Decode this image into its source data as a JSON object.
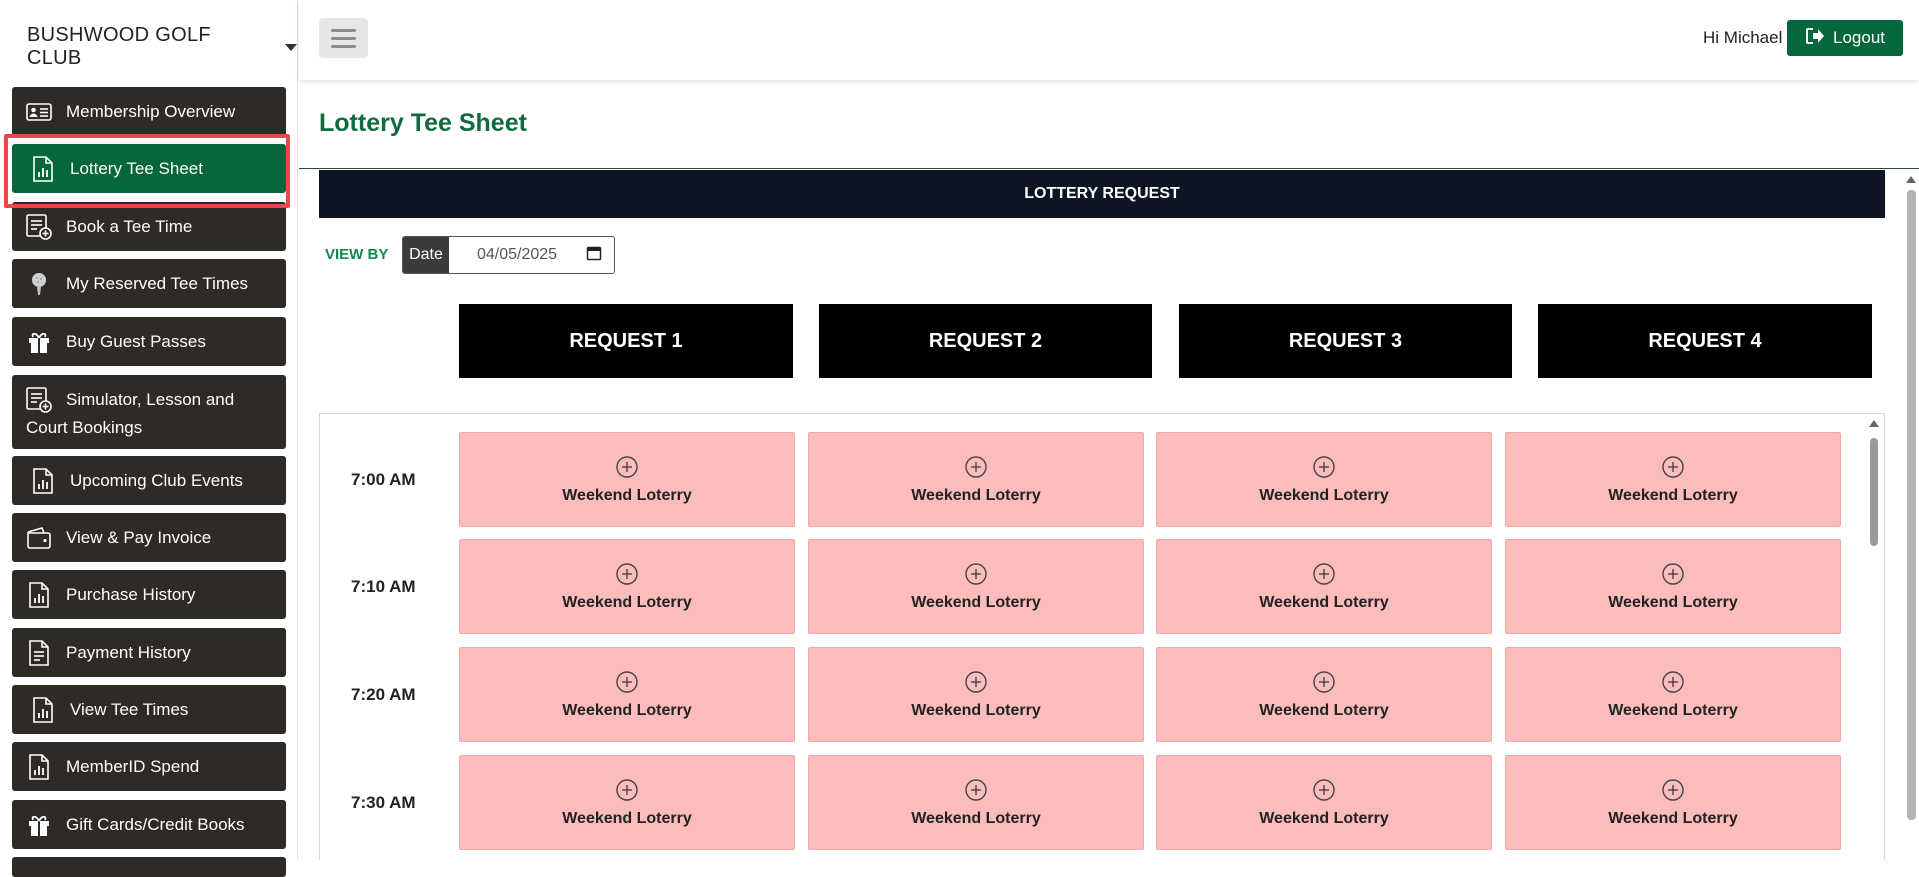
{
  "sidebar": {
    "club_name": "BUSHWOOD GOLF CLUB",
    "items": [
      {
        "label": "Membership Overview",
        "icon": "id-card-icon"
      },
      {
        "label": "Lottery Tee Sheet",
        "icon": "report-icon",
        "active": true
      },
      {
        "label": "Book a Tee Time",
        "icon": "list-add-icon"
      },
      {
        "label": "My Reserved Tee Times",
        "icon": "golf-ball-icon"
      },
      {
        "label": "Buy Guest Passes",
        "icon": "gift-icon"
      },
      {
        "label_line1": "Simulator, Lesson and",
        "label_line2": "Court Bookings",
        "icon": "list-add-icon"
      },
      {
        "label": "Upcoming Club Events",
        "icon": "report-icon"
      },
      {
        "label": "View & Pay Invoice",
        "icon": "wallet-icon"
      },
      {
        "label": "Purchase History",
        "icon": "report-icon"
      },
      {
        "label": "Payment History",
        "icon": "document-icon"
      },
      {
        "label": "View Tee Times",
        "icon": "report-icon"
      },
      {
        "label": "MemberID Spend",
        "icon": "report-icon"
      },
      {
        "label": "Gift Cards/Credit Books",
        "icon": "gift-icon"
      }
    ]
  },
  "header": {
    "greeting": "Hi Michael",
    "logout_label": "Logout"
  },
  "main": {
    "title": "Lottery Tee Sheet",
    "banner": "LOTTERY REQUEST",
    "view_by": "VIEW BY",
    "date_label": "Date",
    "date_value": "04/05/2025",
    "requests": [
      "REQUEST 1",
      "REQUEST 2",
      "REQUEST 3",
      "REQUEST 4"
    ],
    "slot_label": "Weekend Loterry",
    "times": [
      "7:00 AM",
      "7:10 AM",
      "7:20 AM",
      "7:30 AM"
    ]
  },
  "colors": {
    "brand_green": "#05673b",
    "sidebar_dark": "#2e2a26",
    "slot_pink": "#fcbcbc",
    "highlight_red": "#e8474e"
  }
}
